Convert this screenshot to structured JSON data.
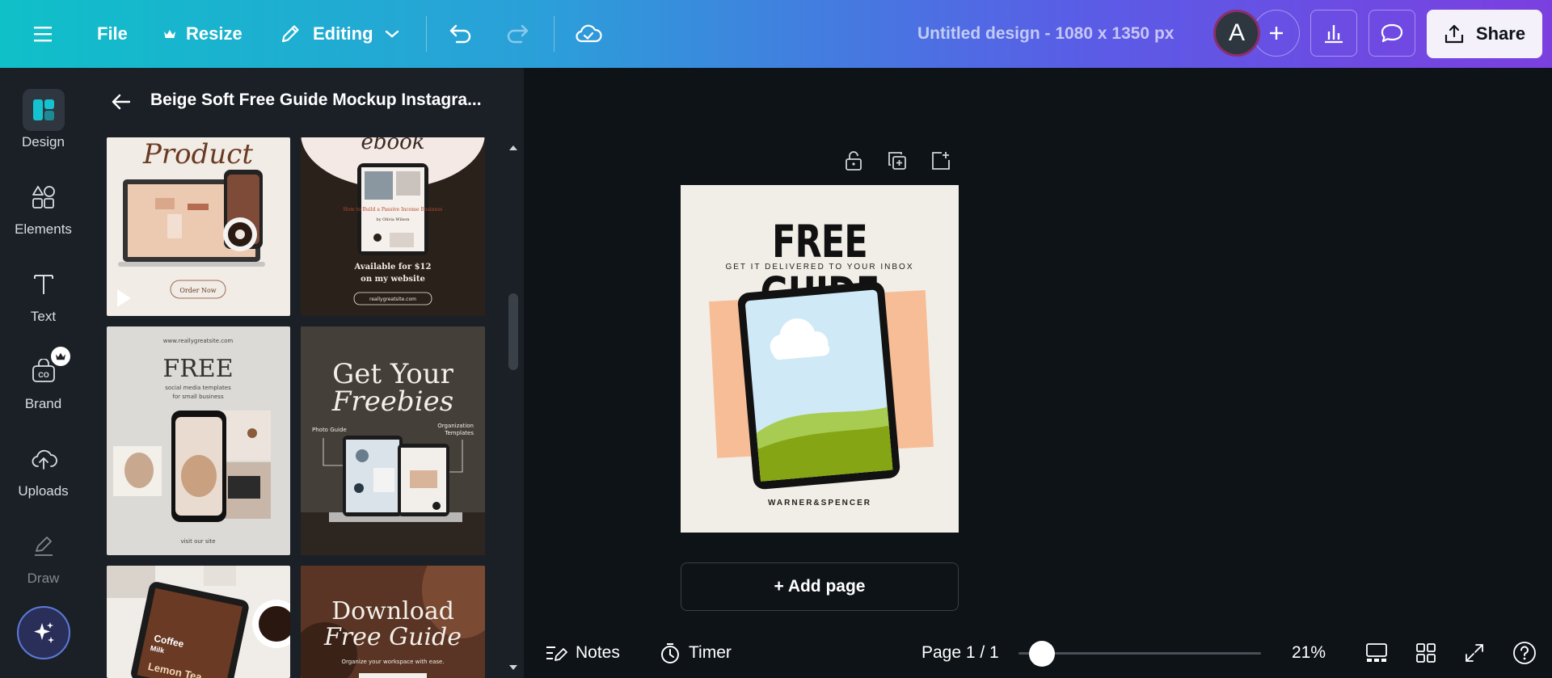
{
  "topbar": {
    "file_label": "File",
    "resize_label": "Resize",
    "editing_label": "Editing",
    "doc_title": "Untitled design - 1080 x 1350 px",
    "avatar_letter": "A",
    "share_label": "Share"
  },
  "rail": {
    "items": [
      {
        "label": "Design",
        "icon": "design-icon"
      },
      {
        "label": "Elements",
        "icon": "elements-icon"
      },
      {
        "label": "Text",
        "icon": "text-icon"
      },
      {
        "label": "Brand",
        "icon": "brand-icon"
      },
      {
        "label": "Uploads",
        "icon": "uploads-icon"
      },
      {
        "label": "Draw",
        "icon": "draw-icon"
      }
    ]
  },
  "panel": {
    "title": "Beige Soft Free Guide Mockup Instagra...",
    "thumbs": {
      "t1": {
        "title": "Product",
        "button": "Order Now"
      },
      "t2": {
        "title": "ebook",
        "book_title": "How to Build a Passive Income Business",
        "book_author": "by Olivia Wilson",
        "price": "Available for $12",
        "sub": "on my website",
        "url": "reallygreatsite.com"
      },
      "t3": {
        "url": "www.reallygreatsite.com",
        "title": "FREE",
        "sub1": "social media templates",
        "sub2": "for small business",
        "footer": "visit our site"
      },
      "t4": {
        "line1": "Get Your",
        "line2": "Freebies",
        "left_label": "Photo Guide",
        "right_label1": "Organization",
        "right_label2": "Templates"
      },
      "t5": {
        "line1": "Coffee",
        "line2": "Milk",
        "line3": "Lemon Tea"
      },
      "t6": {
        "line1": "Download",
        "line2": "Free Guide",
        "sub": "Organize your workspace with ease."
      }
    }
  },
  "design": {
    "title": "FREE GUIDE",
    "subtitle": "GET IT DELIVERED TO YOUR INBOX",
    "brand": "WARNER&SPENCER"
  },
  "canvas": {
    "add_page_label": "+ Add page"
  },
  "bottombar": {
    "notes_label": "Notes",
    "timer_label": "Timer",
    "page_label": "Page 1 / 1",
    "zoom_label": "21%",
    "zoom_value": 21
  },
  "colors": {
    "accent": "#0fc0c8",
    "canvas_bg": "#0e1318",
    "panel_bg": "#1b2027"
  }
}
